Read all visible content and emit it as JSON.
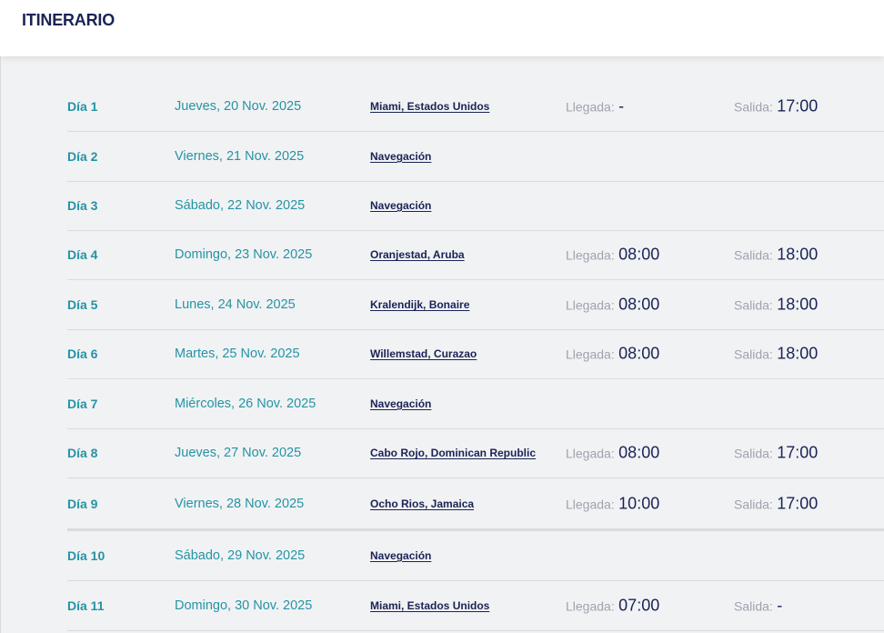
{
  "header": {
    "title": "ITINERARIO"
  },
  "labels": {
    "arrival": "Llegada:",
    "departure": "Salida:"
  },
  "itinerary": [
    {
      "day": "Día 1",
      "date": "Jueves, 20 Nov. 2025",
      "port": "Miami, Estados Unidos",
      "arrival": "-",
      "departure": "17:00"
    },
    {
      "day": "Día 2",
      "date": "Viernes, 21 Nov. 2025",
      "port": "Navegación",
      "arrival": null,
      "departure": null
    },
    {
      "day": "Día 3",
      "date": "Sábado, 22 Nov. 2025",
      "port": "Navegación",
      "arrival": null,
      "departure": null
    },
    {
      "day": "Día 4",
      "date": "Domingo, 23 Nov. 2025",
      "port": "Oranjestad, Aruba",
      "arrival": "08:00",
      "departure": "18:00"
    },
    {
      "day": "Día 5",
      "date": "Lunes, 24 Nov. 2025",
      "port": "Kralendijk, Bonaire",
      "arrival": "08:00",
      "departure": "18:00"
    },
    {
      "day": "Día 6",
      "date": "Martes, 25 Nov. 2025",
      "port": "Willemstad, Curazao",
      "arrival": "08:00",
      "departure": "18:00"
    },
    {
      "day": "Día 7",
      "date": "Miércoles, 26 Nov. 2025",
      "port": "Navegación",
      "arrival": null,
      "departure": null
    },
    {
      "day": "Día 8",
      "date": "Jueves, 27 Nov. 2025",
      "port": "Cabo Rojo, Dominican Republic",
      "arrival": "08:00",
      "departure": "17:00"
    },
    {
      "day": "Día 9",
      "date": "Viernes, 28 Nov. 2025",
      "port": "Ocho Rios, Jamaica",
      "arrival": "10:00",
      "departure": "17:00"
    },
    {
      "day": "Día 10",
      "date": "Sábado, 29 Nov. 2025",
      "port": "Navegación",
      "arrival": null,
      "departure": null
    },
    {
      "day": "Día 11",
      "date": "Domingo, 30 Nov. 2025",
      "port": "Miami, Estados Unidos",
      "arrival": "07:00",
      "departure": "-"
    }
  ]
}
